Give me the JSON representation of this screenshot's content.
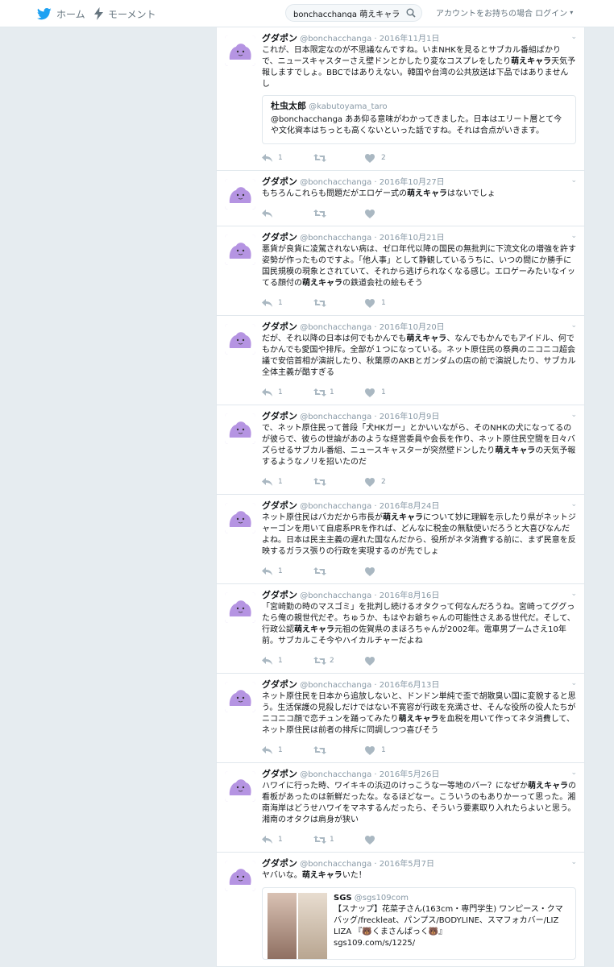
{
  "nav": {
    "home_label": "ホーム",
    "moments_label": "モーメント",
    "search_value": "bonchacchanga 萌えキャラ",
    "login_text": "アカウントをお持ちの場合 ログイン"
  },
  "tweets": [
    {
      "name": "グダポン",
      "handle": "@bonchacchanga",
      "date": "2016年11月1日",
      "text": "これが、日本限定なのが不思議なんですね。いまNHKを見るとサブカル番組ばかりで、ニュースキャスターさえ壁ドンとかしたり変なコスプレをしたり萌えキャラ天気予報しますでしょ。BBCではありえない。韓国や台湾の公共放送は下品ではありませんし",
      "quote": {
        "name": "杜虫太郎",
        "handle": "@kabutoyama_taro",
        "text": "@bonchacchanga ああ仰る意味がわかってきました。日本はエリート層とて今や文化資本はちっとも高くないといった話ですね。それは合点がいきます。"
      },
      "reply": "1",
      "retweet": "",
      "like": "2"
    },
    {
      "name": "グダポン",
      "handle": "@bonchacchanga",
      "date": "2016年10月27日",
      "text": "もちろんこれらも問題だがエロゲー式の萌えキャラはないでしょ",
      "reply": "",
      "retweet": "",
      "like": ""
    },
    {
      "name": "グダポン",
      "handle": "@bonchacchanga",
      "date": "2016年10月21日",
      "text": "悪貨が良貨に凌駕されない病は、ゼロ年代以降の国民の無批判に下流文化の増強を許す姿勢が作ったものですよ。「他人事」として静観しているうちに、いつの間にか勝手に国民規模の現象とされていて、それから逃げられなくなる感じ。エロゲーみたいなイッてる顔付の萌えキャラの鉄道会社の絵もそう",
      "reply": "1",
      "retweet": "",
      "like": "1"
    },
    {
      "name": "グダポン",
      "handle": "@bonchacchanga",
      "date": "2016年10月20日",
      "text": "だが、それ以降の日本は何でもかんでも萌えキャラ、なんでもかんでもアイドル、何でもかんでも愛国や排斥。全部が１つになっている。ネット原住民の祭典のニコニコ超会議で安倍首相が演説したり、秋葉原のAKBとガンダムの店の前で演説したり、サブカル全体主義が酷すぎる",
      "reply": "1",
      "retweet": "1",
      "like": "1"
    },
    {
      "name": "グダポン",
      "handle": "@bonchacchanga",
      "date": "2016年10月9日",
      "text": "で、ネット原住民って普段「犬HKガー」とかいいながら、そのNHKの犬になってるのが彼らで、彼らの世論があのような経営委員や会長を作り、ネット原住民空間を日々バズらせるサブカル番組、ニュースキャスターが突然壁ドンしたり萌えキャラの天気予報するようなノリを招いたのだ",
      "reply": "1",
      "retweet": "",
      "like": "2"
    },
    {
      "name": "グダポン",
      "handle": "@bonchacchanga",
      "date": "2016年8月24日",
      "text": "ネット原住民はバカだから市長が萌えキャラについて妙に理解を示したり県がネットジャーゴンを用いて自虐系PRを作れば、どんなに税金の無駄使いだろうと大喜びなんだよね。日本は民主主義の遅れた国なんだから、役所がネタ消費する前に、まず民意を反映するガラス張りの行政を実現するのが先でしょ",
      "reply": "1",
      "retweet": "",
      "like": ""
    },
    {
      "name": "グダポン",
      "handle": "@bonchacchanga",
      "date": "2016年8月16日",
      "text": "「宮崎勤の時のマスゴミ」を批判し続けるオタクって何なんだろうね。宮崎ってググったら俺の親世代だぞ。ちゅうか、もはやお爺ちゃんの可能性さえある世代だ。そして、行政公認萌えキャラ元祖の佐賀県のまほろちゃんが2002年。電車男ブームさえ10年前。サブカルこそ今やハイカルチャーだよね",
      "reply": "1",
      "retweet": "2",
      "like": ""
    },
    {
      "name": "グダポン",
      "handle": "@bonchacchanga",
      "date": "2016年6月13日",
      "text": "ネット原住民を日本から追放しないと、ドンドン単純で歪で胡散臭い国に変貌すると思う。生活保護の見殺しだけではない不寛容が行政を充満させ、そんな役所の役人たちがニコニコ顔で恋チュンを踊ってみたり萌えキャラを血税を用いて作ってネタ消費して、ネット原住民は前者の排斥に同調しつつ喜びそう",
      "reply": "1",
      "retweet": "",
      "like": "1"
    },
    {
      "name": "グダポン",
      "handle": "@bonchacchanga",
      "date": "2016年5月26日",
      "text": "ハワイに行った時、ワイキキの浜辺のけっこうな一等地のバー？になぜか萌えキャラの看板があったのは新鮮だったな。なるほどなー。こういうのもありかーって思った。湘南海岸はどうせハワイをマネするんだったら、そういう要素取り入れたらよいと思う。湘南のオタクは肩身が狭い",
      "reply": "1",
      "retweet": "1",
      "like": ""
    },
    {
      "name": "グダポン",
      "handle": "@bonchacchanga",
      "date": "2016年5月7日",
      "text": "ヤバいな。萌えキャラいた！",
      "card": {
        "name": "SGS",
        "handle": "@sgs109com",
        "text": "【スナップ】花菜子さん(163cm・専門学生) ワンピース・クマバッグ/freckleat、パンプス/BODYLINE、スマフォカバー/LIZ LIZA 『🐻くまさんぱっく🐻』",
        "url": "sgs109.com/s/1225/"
      }
    }
  ],
  "keyword": "萌えキャラ"
}
